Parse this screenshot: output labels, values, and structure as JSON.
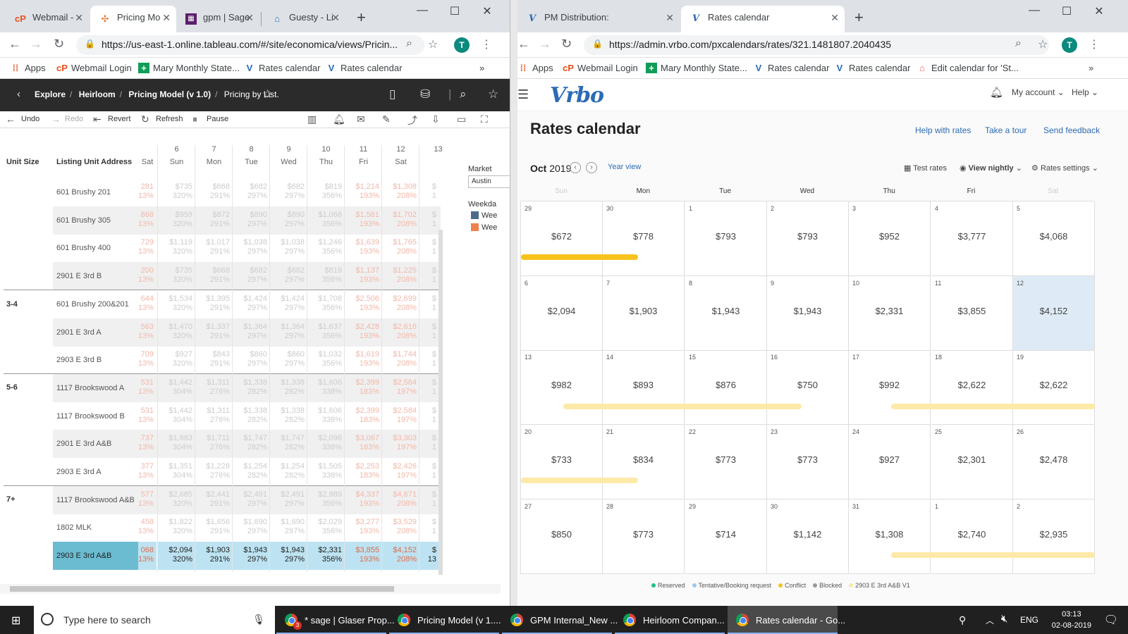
{
  "left_window": {
    "tabs": [
      {
        "icon": "webmail-icon",
        "label": "Webmail -"
      },
      {
        "icon": "tableau-icon",
        "label": "Pricing Mo"
      },
      {
        "icon": "sage-icon",
        "label": "gpm | Sage"
      },
      {
        "icon": "guesty-icon",
        "label": "Guesty - Li"
      }
    ],
    "url": "https://us-east-1.online.tableau.com/#/site/economica/views/Pricin...",
    "bookmarks": [
      {
        "icon": "apps-icon",
        "label": "Apps"
      },
      {
        "icon": "webmail-icon",
        "label": "Webmail Login"
      },
      {
        "icon": "sheets-icon",
        "label": "Mary Monthly State..."
      },
      {
        "icon": "vrbo-icon",
        "label": "Rates calendar"
      },
      {
        "icon": "vrbo-icon",
        "label": "Rates calendar"
      }
    ],
    "avatar": "T",
    "breadcrumb": [
      "Explore",
      "Heirloom",
      "Pricing Model (v 1.0)",
      "Pricing by List."
    ],
    "toolbar": {
      "undo": "Undo",
      "redo": "Redo",
      "revert": "Revert",
      "refresh": "Refresh",
      "pause": "Pause"
    },
    "table": {
      "hdr_unit_size": "Unit Size",
      "hdr_address": "Listing Unit Address",
      "col_first_day": "Sat",
      "columns": [
        {
          "num": "6",
          "day": "Sun"
        },
        {
          "num": "7",
          "day": "Mon"
        },
        {
          "num": "8",
          "day": "Tue"
        },
        {
          "num": "9",
          "day": "Wed"
        },
        {
          "num": "10",
          "day": "Thu"
        },
        {
          "num": "11",
          "day": "Fri"
        },
        {
          "num": "12",
          "day": "Sat"
        },
        {
          "num": "13",
          "day": ""
        }
      ],
      "groups": [
        "3-4",
        "5-6",
        "7+"
      ],
      "rows": [
        {
          "addr": "601 Brushy 201",
          "c0": [
            "281",
            "13%"
          ],
          "cells": [
            [
              "$735",
              "320%"
            ],
            [
              "$668",
              "291%"
            ],
            [
              "$682",
              "297%"
            ],
            [
              "$682",
              "297%"
            ],
            [
              "$819",
              "356%"
            ],
            [
              "$1,214",
              "193%"
            ],
            [
              "$1,308",
              "208%"
            ],
            [
              "$",
              "1"
            ]
          ]
        },
        {
          "addr": "601 Brushy 305",
          "c0": [
            "868",
            "13%"
          ],
          "cells": [
            [
              "$959",
              "320%"
            ],
            [
              "$872",
              "291%"
            ],
            [
              "$890",
              "297%"
            ],
            [
              "$890",
              "297%"
            ],
            [
              "$1,068",
              "356%"
            ],
            [
              "$1,581",
              "193%"
            ],
            [
              "$1,702",
              "208%"
            ],
            [
              "$",
              "1"
            ]
          ]
        },
        {
          "addr": "601 Brushy 400",
          "c0": [
            "729",
            "13%"
          ],
          "cells": [
            [
              "$1,119",
              "320%"
            ],
            [
              "$1,017",
              "291%"
            ],
            [
              "$1,038",
              "297%"
            ],
            [
              "$1,038",
              "297%"
            ],
            [
              "$1,246",
              "356%"
            ],
            [
              "$1,639",
              "193%"
            ],
            [
              "$1,765",
              "208%"
            ],
            [
              "$",
              "1"
            ]
          ]
        },
        {
          "addr": "2901 E 3rd B",
          "c0": [
            "200",
            "13%"
          ],
          "cells": [
            [
              "$735",
              "320%"
            ],
            [
              "$668",
              "291%"
            ],
            [
              "$682",
              "297%"
            ],
            [
              "$682",
              "297%"
            ],
            [
              "$819",
              "356%"
            ],
            [
              "$1,137",
              "193%"
            ],
            [
              "$1,225",
              "208%"
            ],
            [
              "$",
              "1"
            ]
          ]
        },
        {
          "addr": "601 Brushy 200&201",
          "c0": [
            "644",
            "13%"
          ],
          "cells": [
            [
              "$1,534",
              "320%"
            ],
            [
              "$1,395",
              "291%"
            ],
            [
              "$1,424",
              "297%"
            ],
            [
              "$1,424",
              "297%"
            ],
            [
              "$1,708",
              "356%"
            ],
            [
              "$2,506",
              "193%"
            ],
            [
              "$2,699",
              "208%"
            ],
            [
              "$",
              "1"
            ]
          ]
        },
        {
          "addr": "2901 E 3rd A",
          "c0": [
            "563",
            "13%"
          ],
          "cells": [
            [
              "$1,470",
              "320%"
            ],
            [
              "$1,337",
              "291%"
            ],
            [
              "$1,364",
              "297%"
            ],
            [
              "$1,364",
              "297%"
            ],
            [
              "$1,637",
              "356%"
            ],
            [
              "$2,428",
              "193%"
            ],
            [
              "$2,616",
              "208%"
            ],
            [
              "$",
              "1"
            ]
          ]
        },
        {
          "addr": "2903 E 3rd B",
          "c0": [
            "709",
            "13%"
          ],
          "cells": [
            [
              "$927",
              "320%"
            ],
            [
              "$843",
              "291%"
            ],
            [
              "$860",
              "297%"
            ],
            [
              "$860",
              "297%"
            ],
            [
              "$1,032",
              "356%"
            ],
            [
              "$1,619",
              "193%"
            ],
            [
              "$1,744",
              "208%"
            ],
            [
              "$",
              "1"
            ]
          ]
        },
        {
          "addr": "1117 Brookswood A",
          "c0": [
            "531",
            "13%"
          ],
          "cells": [
            [
              "$1,442",
              "304%"
            ],
            [
              "$1,311",
              "276%"
            ],
            [
              "$1,338",
              "282%"
            ],
            [
              "$1,338",
              "282%"
            ],
            [
              "$1,606",
              "338%"
            ],
            [
              "$2,399",
              "183%"
            ],
            [
              "$2,584",
              "197%"
            ],
            [
              "$",
              "1"
            ]
          ]
        },
        {
          "addr": "1117 Brookswood B",
          "c0": [
            "531",
            "13%"
          ],
          "cells": [
            [
              "$1,442",
              "304%"
            ],
            [
              "$1,311",
              "276%"
            ],
            [
              "$1,338",
              "282%"
            ],
            [
              "$1,338",
              "282%"
            ],
            [
              "$1,606",
              "338%"
            ],
            [
              "$2,399",
              "183%"
            ],
            [
              "$2,584",
              "197%"
            ],
            [
              "$",
              "1"
            ]
          ]
        },
        {
          "addr": "2901 E 3rd A&B",
          "c0": [
            "737",
            "13%"
          ],
          "cells": [
            [
              "$1,883",
              "304%"
            ],
            [
              "$1,711",
              "276%"
            ],
            [
              "$1,747",
              "282%"
            ],
            [
              "$1,747",
              "282%"
            ],
            [
              "$2,096",
              "338%"
            ],
            [
              "$3,067",
              "183%"
            ],
            [
              "$3,303",
              "197%"
            ],
            [
              "$",
              "1"
            ]
          ]
        },
        {
          "addr": "2903 E 3rd A",
          "c0": [
            "377",
            "13%"
          ],
          "cells": [
            [
              "$1,351",
              "304%"
            ],
            [
              "$1,228",
              "276%"
            ],
            [
              "$1,254",
              "282%"
            ],
            [
              "$1,254",
              "282%"
            ],
            [
              "$1,505",
              "338%"
            ],
            [
              "$2,253",
              "183%"
            ],
            [
              "$2,426",
              "197%"
            ],
            [
              "$",
              "1"
            ]
          ]
        },
        {
          "addr": "1117 Brookswood A&B",
          "c0": [
            "577",
            "13%"
          ],
          "cells": [
            [
              "$2,685",
              "320%"
            ],
            [
              "$2,441",
              "291%"
            ],
            [
              "$2,491",
              "297%"
            ],
            [
              "$2,491",
              "297%"
            ],
            [
              "$2,989",
              "356%"
            ],
            [
              "$4,337",
              "193%"
            ],
            [
              "$4,671",
              "208%"
            ],
            [
              "$",
              "1"
            ]
          ]
        },
        {
          "addr": "1802 MLK",
          "c0": [
            "458",
            "13%"
          ],
          "cells": [
            [
              "$1,822",
              "320%"
            ],
            [
              "$1,656",
              "291%"
            ],
            [
              "$1,690",
              "297%"
            ],
            [
              "$1,690",
              "297%"
            ],
            [
              "$2,029",
              "356%"
            ],
            [
              "$3,277",
              "193%"
            ],
            [
              "$3,529",
              "208%"
            ],
            [
              "$",
              "1"
            ]
          ]
        },
        {
          "addr": "2903 E 3rd A&B",
          "c0": [
            "068",
            "13%"
          ],
          "cells": [
            [
              "$2,094",
              "320%"
            ],
            [
              "$1,903",
              "291%"
            ],
            [
              "$1,943",
              "297%"
            ],
            [
              "$1,943",
              "297%"
            ],
            [
              "$2,331",
              "356%"
            ],
            [
              "$3,855",
              "193%"
            ],
            [
              "$4,152",
              "208%"
            ],
            [
              "$",
              "13"
            ]
          ]
        }
      ]
    },
    "side": {
      "market_label": "Market",
      "market_value": "Austin",
      "weekday_label": "Weekda",
      "legend": [
        "Wee",
        "Wee"
      ],
      "legend_colors": [
        "#4e6a8a",
        "#f08050"
      ]
    }
  },
  "right_window": {
    "tabs": [
      {
        "icon": "vrbo-icon",
        "label": "PM Distribution:"
      },
      {
        "icon": "vrbo-icon",
        "label": "Rates calendar"
      }
    ],
    "url": "https://admin.vrbo.com/pxcalendars/rates/321.1481807.2040435",
    "avatar": "T",
    "bookmarks": [
      {
        "icon": "apps-icon",
        "label": "Apps"
      },
      {
        "icon": "webmail-icon",
        "label": "Webmail Login"
      },
      {
        "icon": "sheets-icon",
        "label": "Mary Monthly State..."
      },
      {
        "icon": "vrbo-icon",
        "label": "Rates calendar"
      },
      {
        "icon": "vrbo-icon",
        "label": "Rates calendar"
      },
      {
        "icon": "airbnb-icon",
        "label": "Edit calendar for 'St..."
      }
    ],
    "logo": "Vrbo",
    "my_account": "My account",
    "help": "Help",
    "title": "Rates calendar",
    "links": [
      "Help with rates",
      "Take a tour",
      "Send feedback"
    ],
    "month": "Oct",
    "year": "2019",
    "year_view": "Year view",
    "test_rates": "Test rates",
    "view_nightly": "View nightly",
    "rates_settings": "Rates settings",
    "weekdays": [
      "Sun",
      "Mon",
      "Tue",
      "Wed",
      "Thu",
      "Fri",
      "Sat"
    ],
    "weeks": [
      [
        [
          "29",
          "$672"
        ],
        [
          "30",
          "$778"
        ],
        [
          "1",
          "$793"
        ],
        [
          "2",
          "$793"
        ],
        [
          "3",
          "$952"
        ],
        [
          "4",
          "$3,777"
        ],
        [
          "5",
          "$4,068"
        ]
      ],
      [
        [
          "6",
          "$2,094"
        ],
        [
          "7",
          "$1,903"
        ],
        [
          "8",
          "$1,943"
        ],
        [
          "9",
          "$1,943"
        ],
        [
          "10",
          "$2,331"
        ],
        [
          "11",
          "$3,855"
        ],
        [
          "12",
          "$4,152"
        ]
      ],
      [
        [
          "13",
          "$982"
        ],
        [
          "14",
          "$893"
        ],
        [
          "15",
          "$876"
        ],
        [
          "16",
          "$750"
        ],
        [
          "17",
          "$992"
        ],
        [
          "18",
          "$2,622"
        ],
        [
          "19",
          "$2,622"
        ]
      ],
      [
        [
          "20",
          "$733"
        ],
        [
          "21",
          "$834"
        ],
        [
          "22",
          "$773"
        ],
        [
          "23",
          "$773"
        ],
        [
          "24",
          "$927"
        ],
        [
          "25",
          "$2,301"
        ],
        [
          "26",
          "$2,478"
        ]
      ],
      [
        [
          "27",
          "$850"
        ],
        [
          "28",
          "$773"
        ],
        [
          "29",
          "$714"
        ],
        [
          "30",
          "$1,142"
        ],
        [
          "31",
          "$1,308"
        ],
        [
          "1",
          "$2,740"
        ],
        [
          "2",
          "$2,935"
        ]
      ]
    ],
    "legend": [
      {
        "label": "Reserved",
        "color": "#1fbf8f"
      },
      {
        "label": "Tentative/Booking request",
        "color": "#9ec7f0"
      },
      {
        "label": "Conflict",
        "color": "#f8c21c"
      },
      {
        "label": "Blocked",
        "color": "#999999"
      },
      {
        "label": "2903 E 3rd A&B V1",
        "color": "#fde9a8"
      }
    ]
  },
  "taskbar": {
    "search_placeholder": "Type here to search",
    "items": [
      "* sage | Glaser Prop...",
      "Pricing Model (v 1....",
      "GPM Internal_New ...",
      "Heirloom Compan...",
      "Rates calendar - Go..."
    ],
    "badge": "3",
    "lang": "ENG",
    "time": "03:13",
    "date": "02-08-2019"
  }
}
